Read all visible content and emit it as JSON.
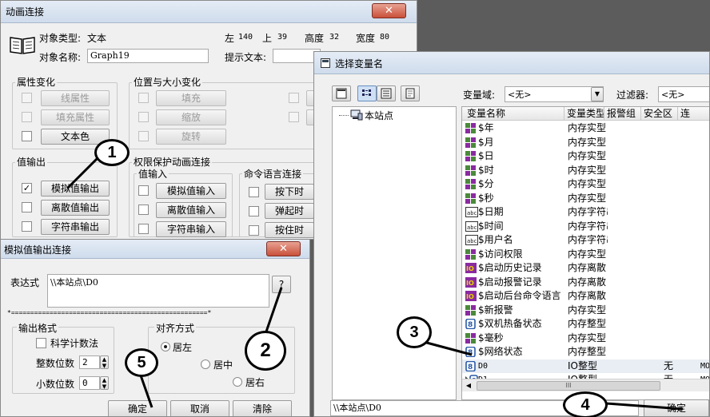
{
  "anim": {
    "title": "动画连接",
    "object_type_label": "对象类型:",
    "object_type_value": "文本",
    "left_label": "左",
    "left_value": "140",
    "top_label": "上",
    "top_value": "39",
    "height_label": "高度",
    "height_value": "32",
    "width_label": "宽度",
    "width_value": "80",
    "object_name_label": "对象名称:",
    "object_name_value": "Graph19",
    "hint_label": "提示文本:",
    "attr_group": "属性变化",
    "attr_buttons": [
      "线属性",
      "填充属性",
      "文本色"
    ],
    "pos_group": "位置与大小变化",
    "pos_buttons": [
      "填充",
      "缩放",
      "旋转"
    ],
    "value_output_group": "值输出",
    "value_output_buttons": [
      "模拟值输出",
      "离散值输出",
      "字符串输出"
    ],
    "value_output_checked": [
      true,
      false,
      false
    ],
    "perm_group": "权限保护动画连接",
    "value_input_group": "值输入",
    "value_input_buttons": [
      "模拟值输入",
      "离散值输入",
      "字符串输入"
    ],
    "command_group": "命令语言连接",
    "command_buttons": [
      "按下时",
      "弹起时",
      "按住时"
    ]
  },
  "analog": {
    "title": "模拟值输出连接",
    "expr_label": "表达式",
    "expr_value": "\\\\本站点\\D0",
    "browse_label": "?",
    "separator": "*===================================================*",
    "format_group": "输出格式",
    "sci_label": "科学计数法",
    "int_digits_label": "整数位数",
    "int_digits_value": "2",
    "dec_digits_label": "小数位数",
    "dec_digits_value": "0",
    "align_group": "对齐方式",
    "align_left": "居左",
    "align_center": "居中",
    "align_right": "居右",
    "ok": "确定",
    "cancel": "取消",
    "clear": "清除"
  },
  "selector": {
    "title": "选择变量名",
    "domain_label": "变量域:",
    "domain_value": "<无>",
    "filter_label": "过滤器:",
    "filter_value": "<无>",
    "tree_root": "本站点",
    "columns": [
      "变量名称",
      "变量类型",
      "报警组",
      "安全区",
      "连"
    ],
    "rows": [
      {
        "icon": "real",
        "name": "$年",
        "type": "内存实型",
        "alarm": "",
        "safe": "",
        "conn": ""
      },
      {
        "icon": "real",
        "name": "$月",
        "type": "内存实型",
        "alarm": "",
        "safe": "",
        "conn": ""
      },
      {
        "icon": "real",
        "name": "$日",
        "type": "内存实型",
        "alarm": "",
        "safe": "",
        "conn": ""
      },
      {
        "icon": "real",
        "name": "$时",
        "type": "内存实型",
        "alarm": "",
        "safe": "",
        "conn": ""
      },
      {
        "icon": "real",
        "name": "$分",
        "type": "内存实型",
        "alarm": "",
        "safe": "",
        "conn": ""
      },
      {
        "icon": "real",
        "name": "$秒",
        "type": "内存实型",
        "alarm": "",
        "safe": "",
        "conn": ""
      },
      {
        "icon": "abc",
        "name": "$日期",
        "type": "内存字符串",
        "alarm": "",
        "safe": "",
        "conn": ""
      },
      {
        "icon": "abc",
        "name": "$时间",
        "type": "内存字符串",
        "alarm": "",
        "safe": "",
        "conn": ""
      },
      {
        "icon": "abc",
        "name": "$用户名",
        "type": "内存字符串",
        "alarm": "",
        "safe": "",
        "conn": ""
      },
      {
        "icon": "real",
        "name": "$访问权限",
        "type": "内存实型",
        "alarm": "",
        "safe": "",
        "conn": ""
      },
      {
        "icon": "io",
        "name": "$启动历史记录",
        "type": "内存离散",
        "alarm": "",
        "safe": "",
        "conn": ""
      },
      {
        "icon": "io",
        "name": "$启动报警记录",
        "type": "内存离散",
        "alarm": "",
        "safe": "",
        "conn": ""
      },
      {
        "icon": "io",
        "name": "$启动后台命令语言",
        "type": "内存离散",
        "alarm": "",
        "safe": "",
        "conn": ""
      },
      {
        "icon": "real",
        "name": "$新报警",
        "type": "内存实型",
        "alarm": "",
        "safe": "",
        "conn": ""
      },
      {
        "icon": "int",
        "name": "$双机热备状态",
        "type": "内存整型",
        "alarm": "",
        "safe": "",
        "conn": ""
      },
      {
        "icon": "real",
        "name": "$毫秒",
        "type": "内存实型",
        "alarm": "",
        "safe": "",
        "conn": ""
      },
      {
        "icon": "int",
        "name": "$网络状态",
        "type": "内存整型",
        "alarm": "",
        "safe": "",
        "conn": ""
      },
      {
        "icon": "int",
        "name": "D0",
        "type": "IO整型",
        "alarm": "",
        "safe": "无",
        "conn": "MO"
      },
      {
        "icon": "int2",
        "name": "D1",
        "type": "IO整型",
        "alarm": "",
        "safe": "无",
        "conn": "MO"
      }
    ],
    "scroll_thumb": "III",
    "path_value": "\\\\本站点\\D0",
    "ok": "确定"
  },
  "callouts": [
    "1",
    "2",
    "3",
    "4",
    "5"
  ],
  "colors": {
    "real_icon": "#4a8a3a",
    "io_icon": "#8a2aa0",
    "int_icon": "#2a5aa8",
    "selected_row": "#e9eef5"
  }
}
